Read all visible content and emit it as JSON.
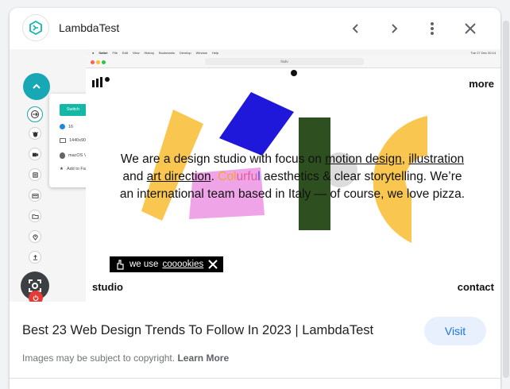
{
  "header": {
    "site_name": "LambdaTest",
    "site_icon": "lambdatest-logo-icon",
    "prev_icon": "chevron-left-icon",
    "next_icon": "chevron-right-icon",
    "menu_icon": "more-vert-icon",
    "close_icon": "close-icon"
  },
  "mac": {
    "menu_items": [
      "Safari",
      "File",
      "Edit",
      "View",
      "History",
      "Bookmarks",
      "Develop",
      "Window",
      "Help"
    ],
    "clock": "Tue 27 Dec 20:14",
    "url": "fisdv"
  },
  "site": {
    "more": "more",
    "studio": "studio",
    "contact": "contact",
    "hero": {
      "p1": "We are a design studio with focus on ",
      "link1": "motion design",
      "p2": ", ",
      "link2": "illustration",
      "p3": " and ",
      "link3": "art direction",
      "p4": ". ",
      "colorful_a": "Col",
      "colorful_b": "urfu",
      "colorful_c": "l",
      "p5": " aesthetics & clear storytelling. We’re an international team based in Italy — of course, we love pizza."
    },
    "cookie": {
      "prefix": "we use ",
      "link": "cooookies"
    }
  },
  "lambda_panel": {
    "switch_label": "Switch",
    "browser_version": "16",
    "resolution": "1440x900",
    "os": "macOS Ventura",
    "favorites": "Add to Favorites"
  },
  "footer": {
    "title": "Best 23 Web Design Trends To Follow In 2023 | LambdaTest",
    "visit_label": "Visit",
    "copyright": "Images may be subject to copyright.",
    "learn_more": "Learn More"
  },
  "colors": {
    "accent_teal": "#14b8a6",
    "visit_bg": "#e8f0fe",
    "visit_text": "#1a73e8",
    "shape_yellow": "#f9c74f",
    "shape_blue": "#1f17d9",
    "shape_pink": "#f0a4e8",
    "shape_green": "#2e4f1f",
    "power_red": "#e53935"
  }
}
